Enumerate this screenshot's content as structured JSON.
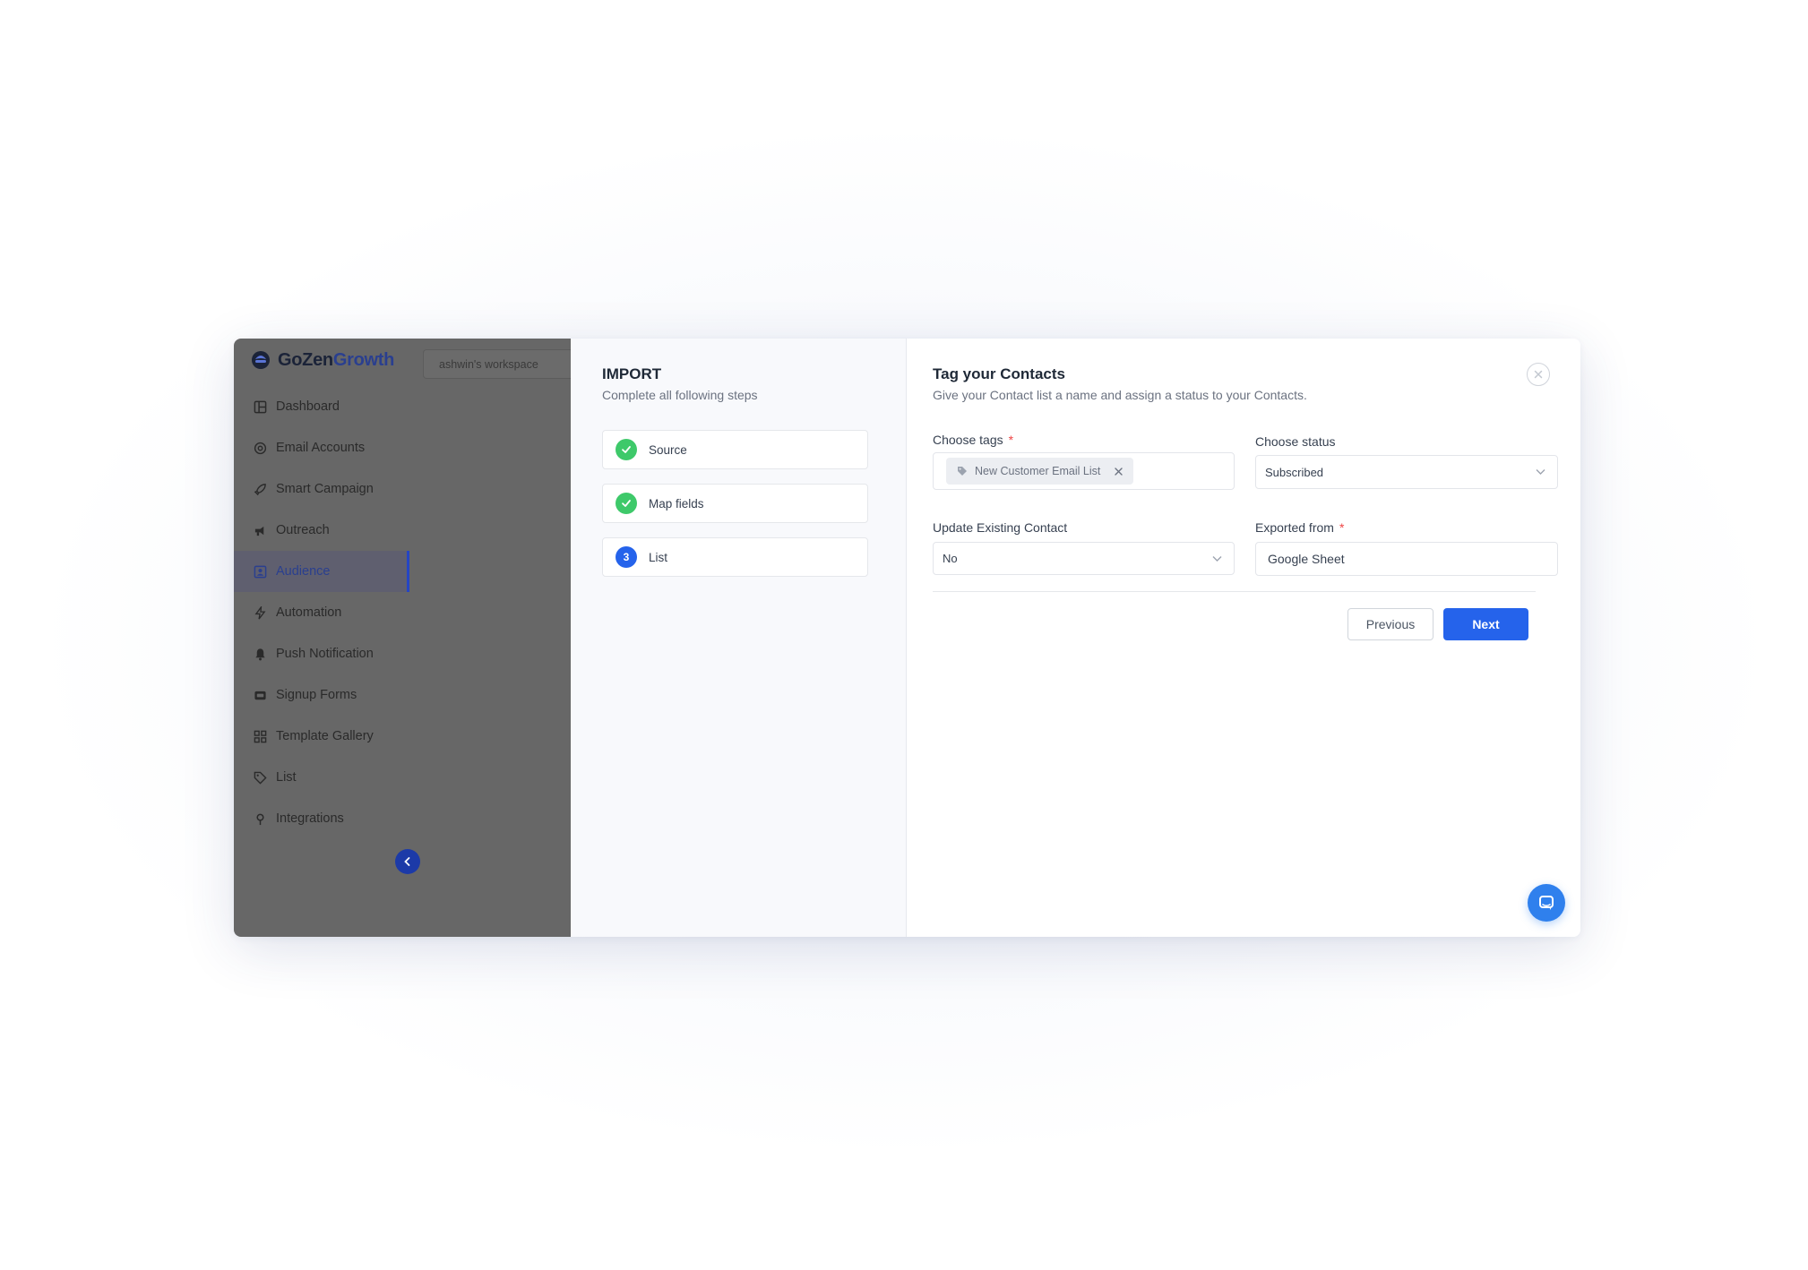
{
  "brand": {
    "name_part1": "GoZen",
    "name_part2": "Growth"
  },
  "workspace": {
    "name": "ashwin's workspace"
  },
  "sidebar": {
    "items": [
      {
        "label": "Dashboard",
        "icon": "dashboard-icon"
      },
      {
        "label": "Email Accounts",
        "icon": "at-sign-icon"
      },
      {
        "label": "Smart Campaign",
        "icon": "rocket-icon"
      },
      {
        "label": "Outreach",
        "icon": "megaphone-icon"
      },
      {
        "label": "Audience",
        "icon": "contacts-icon",
        "active": true
      },
      {
        "label": "Automation",
        "icon": "lightning-icon"
      },
      {
        "label": "Push Notification",
        "icon": "bell-icon"
      },
      {
        "label": "Signup Forms",
        "icon": "form-icon"
      },
      {
        "label": "Template Gallery",
        "icon": "grid-icon"
      },
      {
        "label": "List",
        "icon": "tag-icon"
      },
      {
        "label": "Integrations",
        "icon": "plug-icon"
      }
    ]
  },
  "import": {
    "title": "IMPORT",
    "subtitle": "Complete all following steps",
    "steps": [
      {
        "label": "Source",
        "status": "done"
      },
      {
        "label": "Map fields",
        "status": "done"
      },
      {
        "label": "List",
        "status": "current",
        "number": "3"
      }
    ]
  },
  "form": {
    "title": "Tag your Contacts",
    "subtitle": "Give your Contact list a name and assign a status to your Contacts.",
    "tags_label": "Choose tags",
    "required_mark": "*",
    "tag_chip": "New Customer Email List",
    "status_label": "Choose status",
    "status_value": "Subscribed",
    "update_label": "Update Existing Contact",
    "update_value": "No",
    "exported_label": "Exported from",
    "exported_value": "Google Sheet",
    "previous_label": "Previous",
    "next_label": "Next"
  },
  "colors": {
    "accent": "#2563eb",
    "success": "#3ec96a",
    "required": "#ef4444",
    "chat": "#2f80ed"
  }
}
